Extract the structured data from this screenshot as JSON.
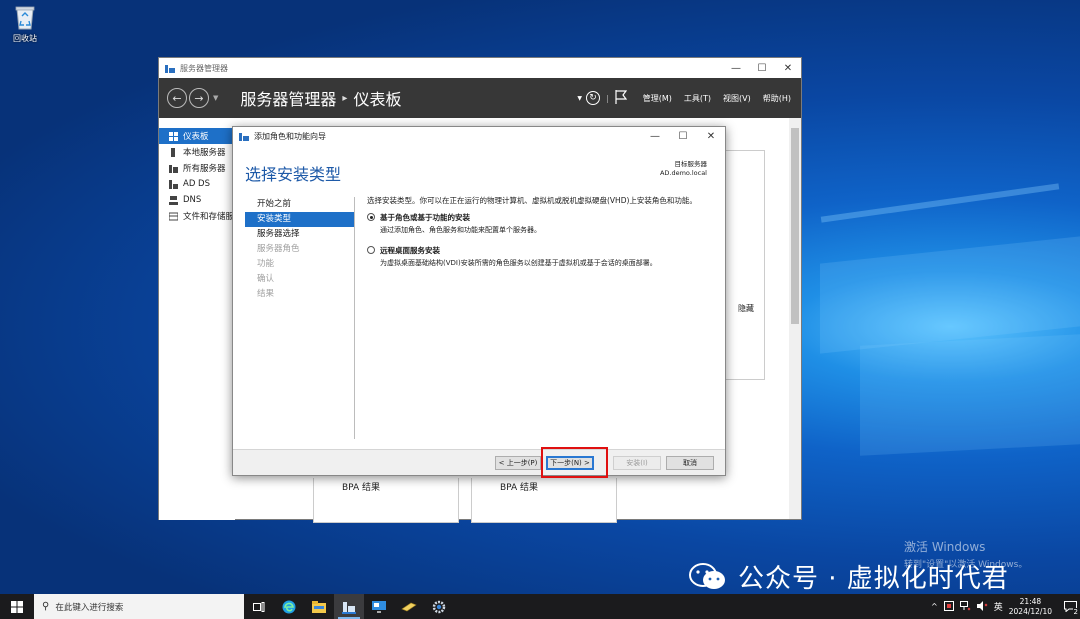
{
  "desktop": {
    "recycle_bin_label": "回收站",
    "activate_title": "激活 Windows",
    "activate_sub": "转到\"设置\"以激活 Windows。",
    "wechat_watermark": "公众号 · 虚拟化时代君"
  },
  "server_manager": {
    "window_title": "服务器管理器",
    "breadcrumb_root": "服务器管理器",
    "breadcrumb_sep": "▸",
    "breadcrumb_page": "仪表板",
    "menu": [
      "管理(M)",
      "工具(T)",
      "视图(V)",
      "帮助(H)"
    ],
    "nav": [
      {
        "label": "仪表板",
        "icon": "dashboard-icon"
      },
      {
        "label": "本地服务器",
        "icon": "server-icon"
      },
      {
        "label": "所有服务器",
        "icon": "servers-icon"
      },
      {
        "label": "AD DS",
        "icon": "ad-ds-icon"
      },
      {
        "label": "DNS",
        "icon": "dns-icon"
      },
      {
        "label": "文件和存储服务",
        "icon": "storage-icon"
      }
    ],
    "hide_label": "隐藏",
    "bpa_label_1": "BPA 结果",
    "bpa_label_2": "BPA 结果"
  },
  "wizard": {
    "window_title": "添加角色和功能向导",
    "heading": "选择安装类型",
    "target_label": "目标服务器",
    "target_server": "AD.demo.local",
    "steps": [
      {
        "label": "开始之前",
        "state": "normal"
      },
      {
        "label": "安装类型",
        "state": "active"
      },
      {
        "label": "服务器选择",
        "state": "normal"
      },
      {
        "label": "服务器角色",
        "state": "disabled"
      },
      {
        "label": "功能",
        "state": "disabled"
      },
      {
        "label": "确认",
        "state": "disabled"
      },
      {
        "label": "结果",
        "state": "disabled"
      }
    ],
    "description": "选择安装类型。你可以在正在运行的物理计算机、虚拟机或脱机虚拟硬盘(VHD)上安装角色和功能。",
    "options": [
      {
        "title": "基于角色或基于功能的安装",
        "desc": "通过添加角色、角色服务和功能来配置单个服务器。",
        "selected": true
      },
      {
        "title": "远程桌面服务安装",
        "desc": "为虚拟桌面基础结构(VDI)安装所需的角色服务以创建基于虚拟机或基于会话的桌面部署。",
        "selected": false
      }
    ],
    "buttons": {
      "previous": "< 上一步(P)",
      "next": "下一步(N) >",
      "install": "安装(I)",
      "cancel": "取消"
    }
  },
  "taskbar": {
    "search_placeholder": "在此键入进行搜索",
    "ime": "英",
    "time": "21:48",
    "date": "2024/12/10",
    "tray_chevron": "^",
    "notification_count": "2"
  }
}
